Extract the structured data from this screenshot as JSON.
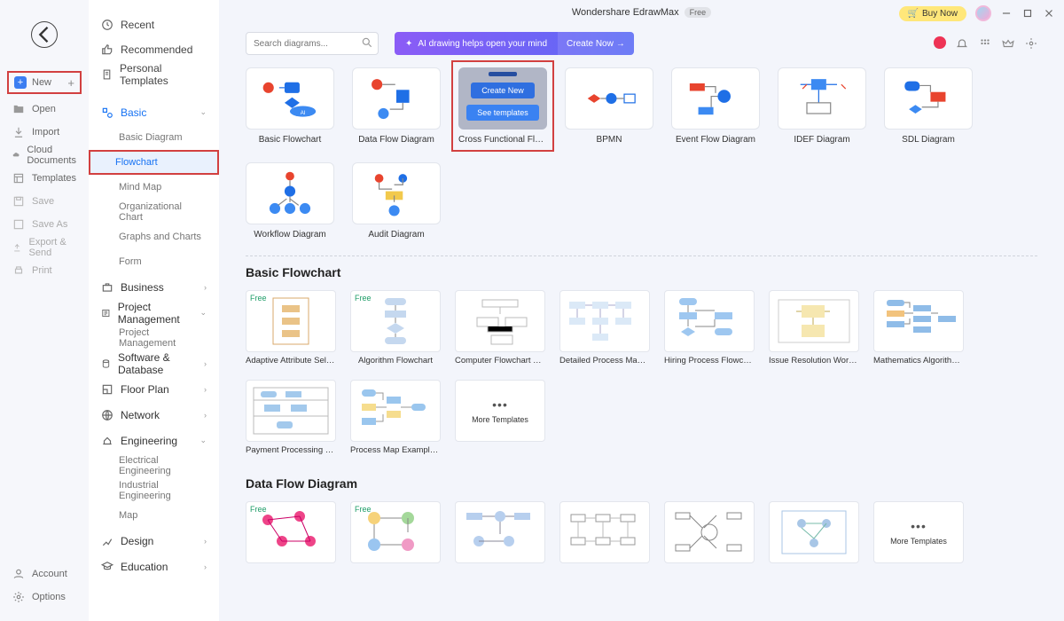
{
  "title": {
    "app": "Wondershare EdrawMax",
    "badge": "Free",
    "buy": "Buy Now"
  },
  "rail": {
    "new": "New",
    "open": "Open",
    "import": "Import",
    "cloud": "Cloud Documents",
    "templates": "Templates",
    "save": "Save",
    "saveas": "Save As",
    "export": "Export & Send",
    "print": "Print",
    "account": "Account",
    "options": "Options"
  },
  "sidebar": {
    "recent": "Recent",
    "recommended": "Recommended",
    "personal": "Personal Templates",
    "basic": "Basic",
    "basic_sub": {
      "bd": "Basic Diagram",
      "fc": "Flowchart",
      "mm": "Mind Map",
      "oc": "Organizational Chart",
      "gc": "Graphs and Charts",
      "fm": "Form"
    },
    "business": "Business",
    "pm": "Project Management",
    "pm_sub": "Project Management",
    "sd": "Software & Database",
    "fp": "Floor Plan",
    "nw": "Network",
    "eng": "Engineering",
    "eng_sub": {
      "ee": "Electrical Engineering",
      "ie": "Industrial Engineering",
      "map": "Map"
    },
    "design": "Design",
    "edu": "Education"
  },
  "search": {
    "placeholder": "Search diagrams..."
  },
  "ai": {
    "text": "AI drawing helps open your mind",
    "cta": "Create Now"
  },
  "topcards": [
    {
      "label": "Basic Flowchart"
    },
    {
      "label": "Data Flow Diagram"
    },
    {
      "label": "Cross Functional Flow...",
      "create": "Create New",
      "see": "See templates"
    },
    {
      "label": "BPMN"
    },
    {
      "label": "Event Flow Diagram"
    },
    {
      "label": "IDEF Diagram"
    },
    {
      "label": "SDL Diagram"
    },
    {
      "label": "Workflow Diagram"
    },
    {
      "label": "Audit Diagram"
    }
  ],
  "sections": {
    "s1": {
      "title": "Basic Flowchart",
      "tpls": [
        {
          "label": "Adaptive Attribute Selectio...",
          "free": "Free"
        },
        {
          "label": "Algorithm Flowchart",
          "free": "Free"
        },
        {
          "label": "Computer Flowchart Temp..."
        },
        {
          "label": "Detailed Process Map Tem..."
        },
        {
          "label": "Hiring Process Flowchart"
        },
        {
          "label": "Issue Resolution Workflow ..."
        },
        {
          "label": "Mathematics Algorithm Fl..."
        },
        {
          "label": "Payment Processing Workf..."
        },
        {
          "label": "Process Map Examples Te..."
        }
      ],
      "more": "More Templates"
    },
    "s2": {
      "title": "Data Flow Diagram",
      "tpls": [
        {
          "label": "",
          "free": "Free"
        },
        {
          "label": "",
          "free": "Free"
        },
        {
          "label": ""
        },
        {
          "label": ""
        },
        {
          "label": ""
        },
        {
          "label": ""
        }
      ],
      "more": "More Templates"
    }
  }
}
